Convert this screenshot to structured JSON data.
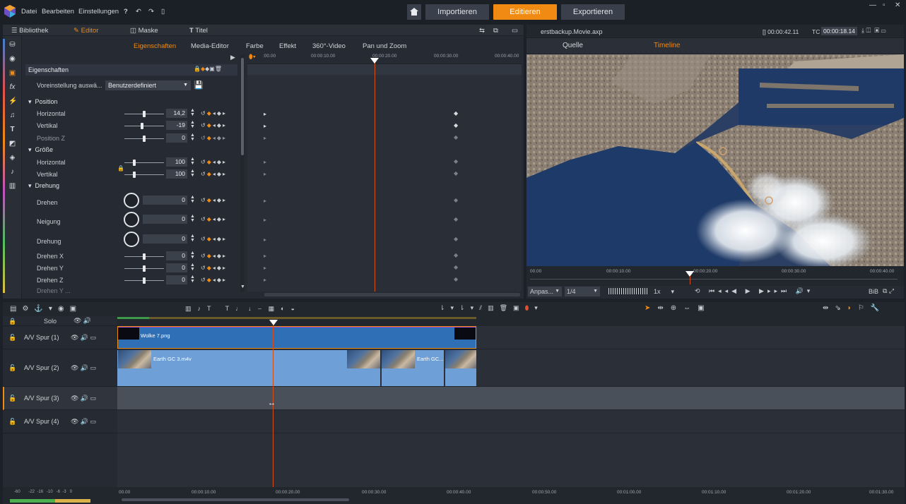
{
  "app": {
    "menu": [
      "Datei",
      "Bearbeiten",
      "Einstellungen"
    ],
    "modes": {
      "import": "Importieren",
      "edit": "Editieren",
      "export": "Exportieren"
    },
    "accent": "#f08a12"
  },
  "library_tabs": [
    {
      "label": "Bibliothek",
      "icon": "library-icon"
    },
    {
      "label": "Editor",
      "icon": "editor-icon",
      "active": true
    },
    {
      "label": "Maske",
      "icon": "mask-icon"
    },
    {
      "label": "Titel",
      "icon": "title-icon"
    }
  ],
  "editor_subtabs": [
    "Eigenschaften",
    "Media-Editor",
    "Farbe",
    "Effekt",
    "360°-Video",
    "Pan und Zoom"
  ],
  "properties": {
    "header": "Eigenschaften",
    "preset_label": "Voreinstellung auswä...",
    "preset_value": "Benutzerdefiniert",
    "sections": {
      "position": "Position",
      "size": "Größe",
      "rotation": "Drehung"
    },
    "rows": {
      "pos_h": {
        "label": "Horizontal",
        "value": "14,2"
      },
      "pos_v": {
        "label": "Vertikal",
        "value": "-19"
      },
      "pos_z": {
        "label": "Position Z",
        "value": "0"
      },
      "size_h": {
        "label": "Horizontal",
        "value": "100"
      },
      "size_v": {
        "label": "Vertikal",
        "value": "100"
      },
      "rot": {
        "label": "Drehen",
        "value": "0"
      },
      "tilt": {
        "label": "Neigung",
        "value": "0"
      },
      "spin": {
        "label": "Drehung",
        "value": "0"
      },
      "rot_x": {
        "label": "Drehen X",
        "value": "0"
      },
      "rot_y": {
        "label": "Drehen Y",
        "value": "0"
      },
      "rot_z": {
        "label": "Drehen Z",
        "value": "0"
      },
      "cut": {
        "label": "Drehen Y ..."
      }
    }
  },
  "keyframe_ruler": [
    ":00.00",
    "00:00:10.00",
    "00:00:20.00",
    "00:00:30.00",
    "00:00:40.00"
  ],
  "preview": {
    "filename": "erstbackup.Movie.axp",
    "duration": "00:00:42.11",
    "tc_label": "TC",
    "timecode": "00:00:18.14",
    "tabs": [
      "Quelle",
      "Timeline"
    ],
    "ruler": [
      "00.00",
      "00:00:10.00",
      "00:00:20.00",
      "00:00:30.00",
      "00:00:40.00"
    ],
    "fit": "Anpas...",
    "quality": "1/4",
    "speed": "1x",
    "bib": "BiB"
  },
  "timeline": {
    "solo": "Solo",
    "tracks": [
      {
        "name": "A/V Spur (1)"
      },
      {
        "name": "A/V Spur (2)"
      },
      {
        "name": "A/V Spur (3)"
      },
      {
        "name": "A/V Spur (4)"
      }
    ],
    "clips": {
      "wolke": "Wolke 7.png",
      "earth1": "Earth GC 3.m4v",
      "earth2": "Earth GC..."
    },
    "ruler": [
      "00.00",
      "00:00:10.00",
      "00:00:20.00",
      "00:00:30.00",
      "00:00:40.00",
      "00:00:50.00",
      "00:01:00.00",
      "00:01:10.00",
      "00:01:20.00",
      "00:01:30.00"
    ],
    "meter_labels": [
      "-60",
      "-22",
      "-16",
      "-10",
      "-6",
      "-3",
      "0"
    ]
  }
}
